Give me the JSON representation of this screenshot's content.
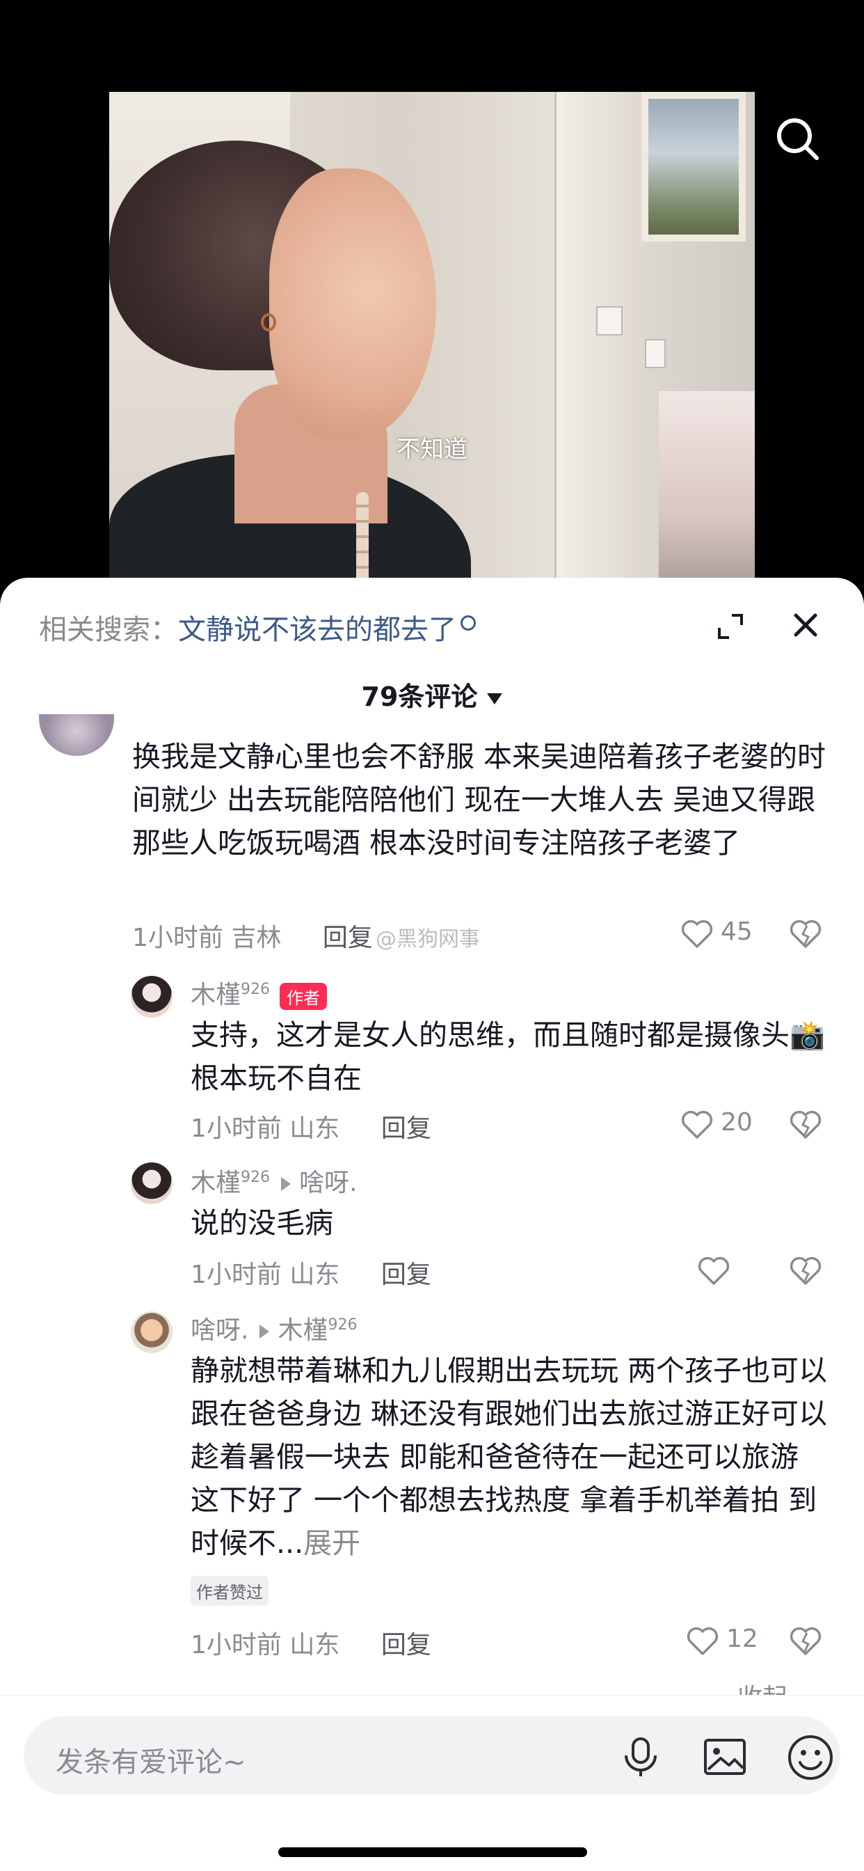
{
  "video": {
    "subtitle": "不知道"
  },
  "sheet": {
    "related_label": "相关搜索：",
    "related_query": "文静说不该去的都去了",
    "comment_count": "79条评论"
  },
  "comments": [
    {
      "text": "换我是文静心里也会不舒服   本来吴迪陪着孩子老婆的时间就少   出去玩能陪陪他们   现在一大堆人去   吴迪又得跟那些人吃饭玩喝酒   根本没时间专注陪孩子老婆了",
      "time": "1小时前",
      "location": "吉林",
      "reply": "回复",
      "likes": "45",
      "watermark": "@黑狗网事"
    }
  ],
  "replies": [
    {
      "user": "木槿",
      "user_sup": "926",
      "tag": "作者",
      "text": "支持，这才是女人的思维，而且随时都是摄像头📸根本玩不自在",
      "time": "1小时前",
      "location": "山东",
      "reply": "回复",
      "likes": "20"
    },
    {
      "user": "木槿",
      "user_sup": "926",
      "to_user": "啥呀.",
      "text": "说的没毛病",
      "time": "1小时前",
      "location": "山东",
      "reply": "回复",
      "likes": ""
    },
    {
      "user": "啥呀.",
      "to_user": "木槿",
      "to_user_sup": "926",
      "text": "静就想带着琳和九儿假期出去玩玩 两个孩子也可以跟在爸爸身边 琳还没有跟她们出去旅过游正好可以趁着暑假一块去 即能和爸爸待在一起还可以旅游 这下好了 一个个都想去找热度 拿着手机举着拍 到时候不...",
      "expand": "展开",
      "liked_tag": "作者赞过",
      "time": "1小时前",
      "location": "山东",
      "reply": "回复",
      "likes": "12"
    }
  ],
  "collapse": "收起",
  "input": {
    "placeholder": "发条有爱评论~"
  }
}
